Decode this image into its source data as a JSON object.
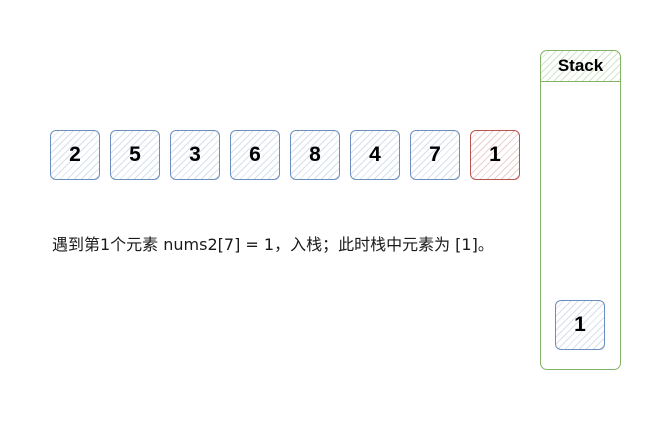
{
  "array": {
    "values": [
      "2",
      "5",
      "3",
      "6",
      "8",
      "4",
      "7",
      "1"
    ],
    "current_index": 7
  },
  "stack": {
    "title": "Stack",
    "items": [
      "1"
    ]
  },
  "caption": "遇到第1个元素 nums2[7] = 1，入栈；此时栈中元素为 [1]。",
  "colors": {
    "array_border": "#6c8ebf",
    "current_border": "#b85450",
    "stack_border": "#82b366"
  }
}
